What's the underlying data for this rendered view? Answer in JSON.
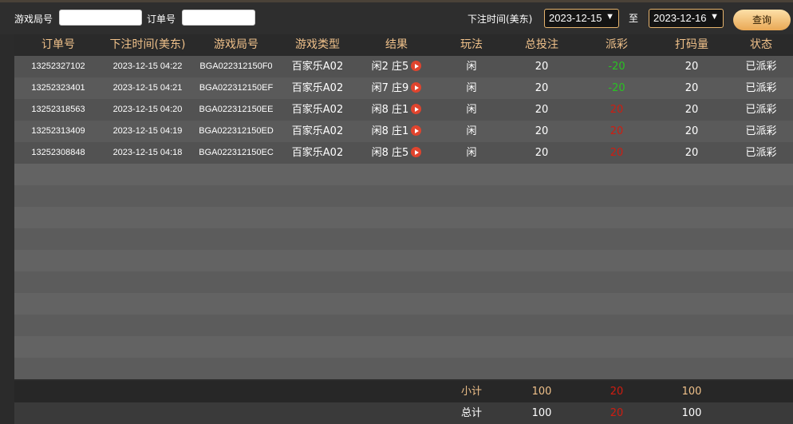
{
  "filters": {
    "game_round_label": "游戏局号",
    "game_round_value": "",
    "order_label": "订单号",
    "order_value": "",
    "time_label": "下注时间(美东)",
    "date_from": "2023-12-15",
    "to_label": "至",
    "date_to": "2023-12-16",
    "query_label": "查询"
  },
  "columns": [
    "订单号",
    "下注时间(美东)",
    "游戏局号",
    "游戏类型",
    "结果",
    "玩法",
    "总投注",
    "派彩",
    "打码量",
    "状态"
  ],
  "rows": [
    {
      "order": "13252327102",
      "time": "2023-12-15 04:22",
      "round": "BGA022312150F0",
      "game": "百家乐A02",
      "result": "闲2 庄5",
      "play": "闲",
      "bet": "20",
      "payout": "-20",
      "payout_color": "#29c322",
      "turnover": "20",
      "status": "已派彩"
    },
    {
      "order": "13252323401",
      "time": "2023-12-15 04:21",
      "round": "BGA022312150EF",
      "game": "百家乐A02",
      "result": "闲7 庄9",
      "play": "闲",
      "bet": "20",
      "payout": "-20",
      "payout_color": "#29c322",
      "turnover": "20",
      "status": "已派彩"
    },
    {
      "order": "13252318563",
      "time": "2023-12-15 04:20",
      "round": "BGA022312150EE",
      "game": "百家乐A02",
      "result": "闲8 庄1",
      "play": "闲",
      "bet": "20",
      "payout": "20",
      "payout_color": "#d01c10",
      "turnover": "20",
      "status": "已派彩"
    },
    {
      "order": "13252313409",
      "time": "2023-12-15 04:19",
      "round": "BGA022312150ED",
      "game": "百家乐A02",
      "result": "闲8 庄1",
      "play": "闲",
      "bet": "20",
      "payout": "20",
      "payout_color": "#d01c10",
      "turnover": "20",
      "status": "已派彩"
    },
    {
      "order": "13252308848",
      "time": "2023-12-15 04:18",
      "round": "BGA022312150EC",
      "game": "百家乐A02",
      "result": "闲8 庄5",
      "play": "闲",
      "bet": "20",
      "payout": "20",
      "payout_color": "#d01c10",
      "turnover": "20",
      "status": "已派彩"
    }
  ],
  "empty_rows": 10,
  "subtotal": {
    "label": "小计",
    "bet": "100",
    "payout": "20",
    "turnover": "100"
  },
  "total": {
    "label": "总计",
    "bet": "100",
    "payout": "20",
    "turnover": "100"
  },
  "colors": {
    "header_text": "#f0c18a",
    "accent": "#e6b46e",
    "loss_green": "#29c322",
    "win_red": "#d01c10"
  }
}
